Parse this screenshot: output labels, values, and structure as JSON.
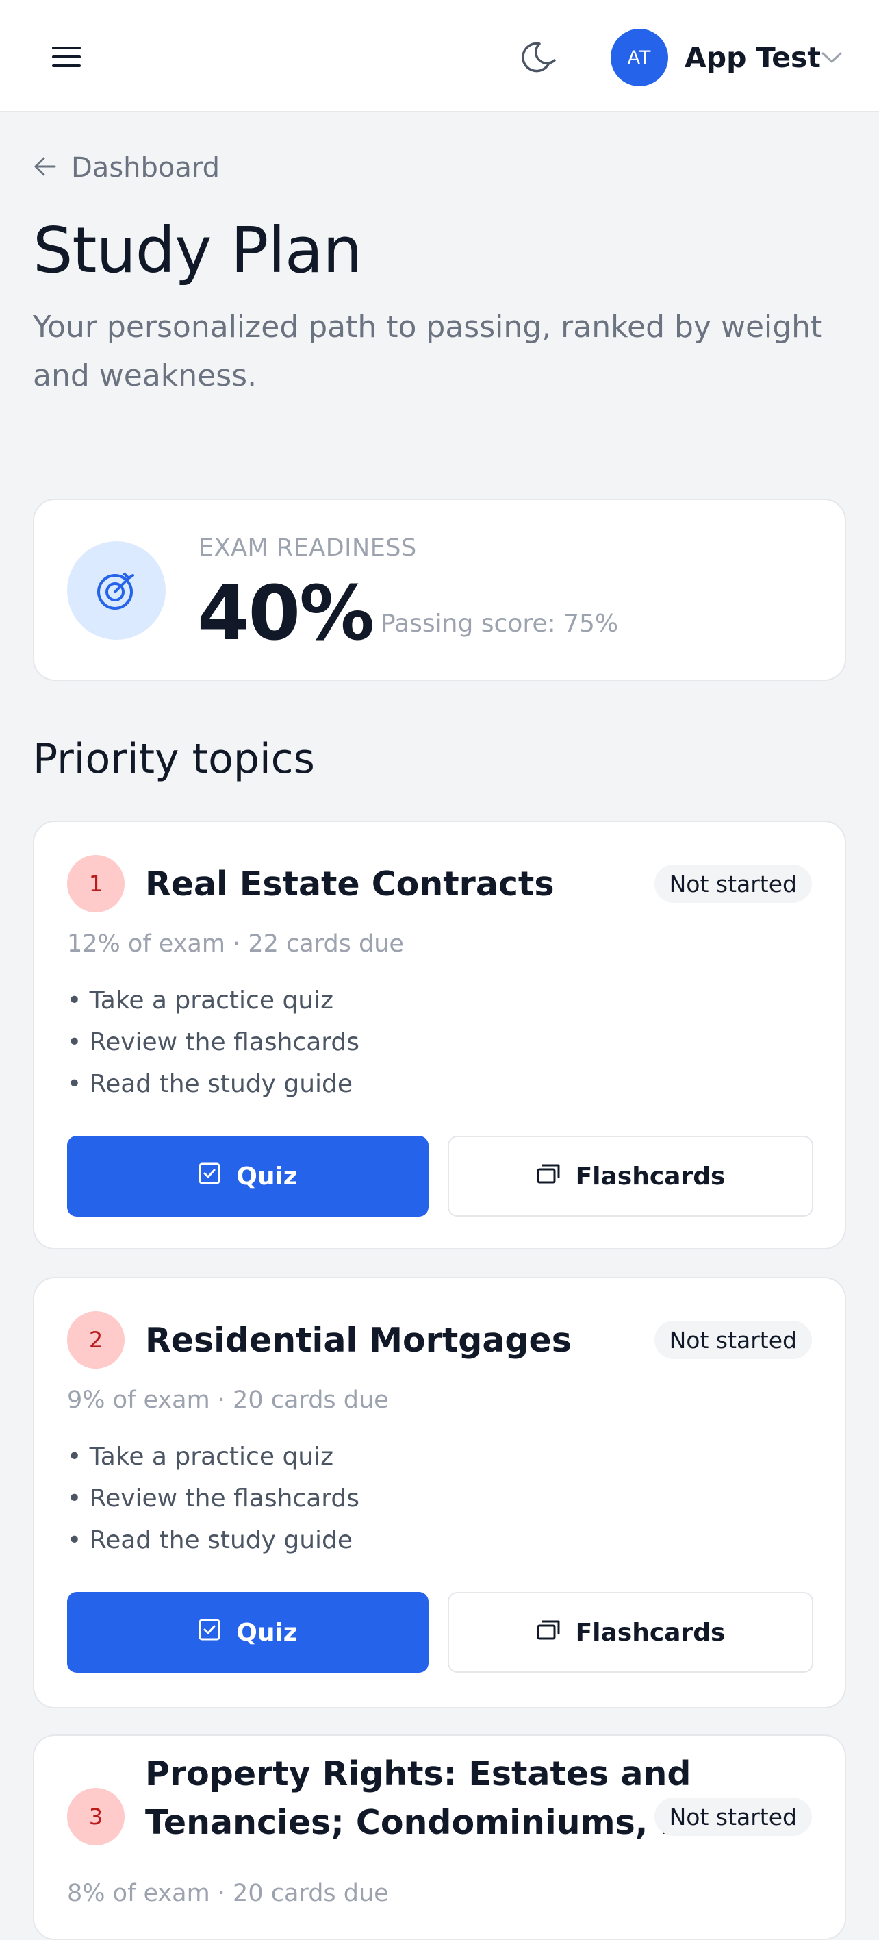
{
  "header": {
    "menu_icon": "hamburger-menu-icon",
    "theme_icon": "moon-icon",
    "avatar_initials": "AT",
    "user_name": "App Test",
    "user_menu_icon": "chevron-down-icon",
    "accent": "#2563eb"
  },
  "breadcrumb": {
    "icon": "arrow-left-icon",
    "label": "Dashboard"
  },
  "page": {
    "title": "Study Plan",
    "subtitle": "Your personalized path to passing, ranked by weight and weakness."
  },
  "readiness": {
    "icon": "target-icon",
    "label": "EXAM READINESS",
    "value": "40%",
    "passing": "Passing score: 75%"
  },
  "priority": {
    "title": "Priority topics",
    "topics": [
      {
        "number": "1",
        "title": "Real Estate Contracts",
        "status": "Not started",
        "meta": "12% of exam · 22 cards due",
        "steps": [
          "• Take a practice quiz",
          "• Review the flashcards",
          "• Read the study guide"
        ],
        "quiz_label": "Quiz",
        "flashcards_label": "Flashcards"
      },
      {
        "number": "2",
        "title": "Residential Mortgages",
        "status": "Not started",
        "meta": "9% of exam · 20 cards due",
        "steps": [
          "• Take a practice quiz",
          "• Review the flashcards",
          "• Read the study guide"
        ],
        "quiz_label": "Quiz",
        "flashcards_label": "Flashcards"
      },
      {
        "number": "3",
        "title_line1": "Property Rights: Estates and",
        "title_line2": "Tenancies; Condominiums, ...",
        "status": "Not started",
        "meta": "8% of exam · 20 cards due"
      }
    ]
  },
  "colors": {
    "primary": "#2563eb",
    "badge_bg": "#fecaca",
    "badge_text": "#b91c1c",
    "page_bg": "#f3f4f6"
  }
}
